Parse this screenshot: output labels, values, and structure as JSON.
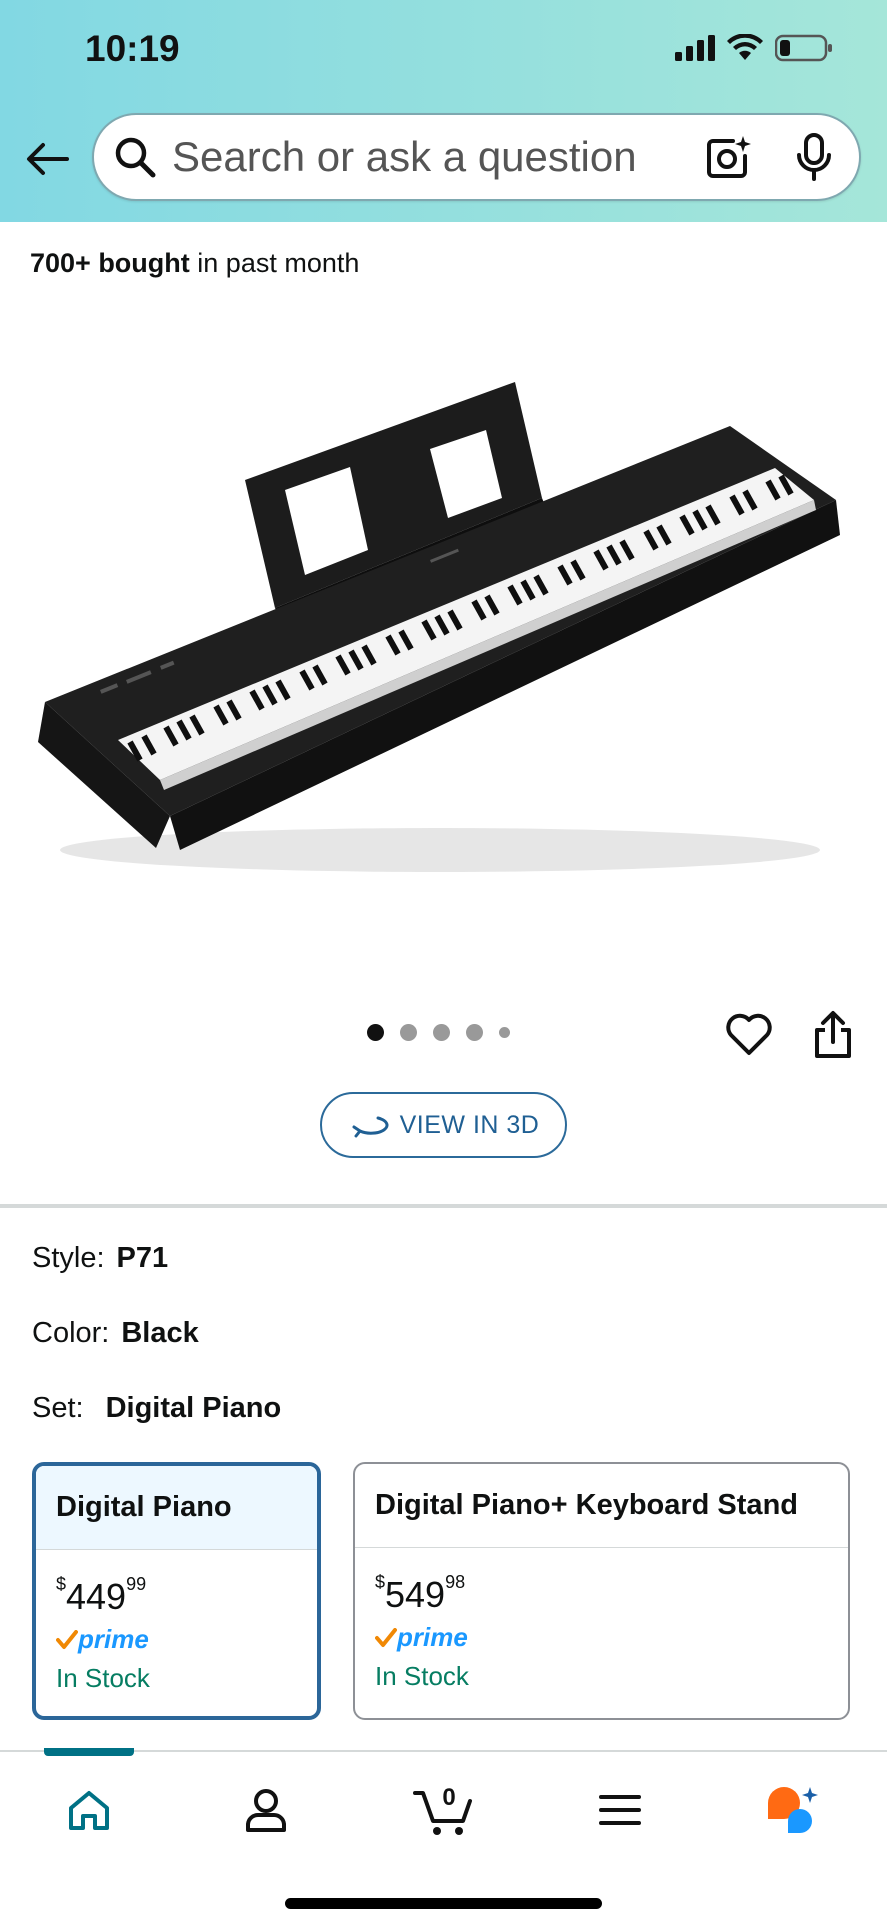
{
  "status": {
    "time": "10:19"
  },
  "search": {
    "placeholder": "Search or ask a question"
  },
  "product": {
    "bought_count": "700+ bought",
    "bought_suffix": " in past month",
    "view_3d_label": "VIEW IN 3D",
    "image_count": 5,
    "active_image": 1
  },
  "variations": {
    "style_label": "Style:",
    "style_value": "P71",
    "color_label": "Color:",
    "color_value": "Black",
    "set_label": "Set:",
    "set_value": "Digital Piano"
  },
  "options": [
    {
      "title": "Digital Piano",
      "price_symbol": "$",
      "price_whole": "449",
      "price_fraction": "99",
      "prime": "prime",
      "stock": "In Stock",
      "selected": true
    },
    {
      "title": "Digital Piano+ Keyboard Stand",
      "price_symbol": "$",
      "price_whole": "549",
      "price_fraction": "98",
      "prime": "prime",
      "stock": "In Stock",
      "selected": false
    }
  ],
  "nav": {
    "items": [
      "home-icon",
      "account-icon",
      "cart-icon",
      "menu-icon",
      "ai-assistant-icon"
    ],
    "cart_count": "0"
  },
  "colors": {
    "header_gradient_start": "#82d8e3",
    "header_gradient_end": "#a5e6d9",
    "selected_border": "#2b6699",
    "stock_green": "#067d62",
    "prime_blue": "#1a98ff",
    "nav_active": "#007185"
  }
}
